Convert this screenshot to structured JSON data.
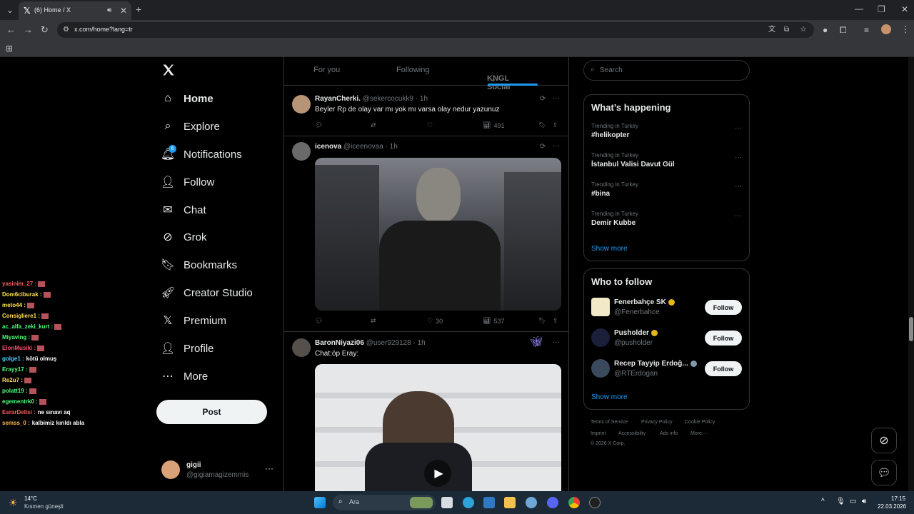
{
  "browser": {
    "tab_title": "(6) Home / X",
    "url": "x.com/home?lang=tr"
  },
  "nav": {
    "items": [
      {
        "label": "Home",
        "icon": "home-icon"
      },
      {
        "label": "Explore",
        "icon": "search-icon"
      },
      {
        "label": "Notifications",
        "icon": "bell-icon",
        "badge": "6"
      },
      {
        "label": "Follow",
        "icon": "person-plus-icon"
      },
      {
        "label": "Chat",
        "icon": "envelope-icon"
      },
      {
        "label": "Grok",
        "icon": "grok-icon"
      },
      {
        "label": "Bookmarks",
        "icon": "bookmark-icon"
      },
      {
        "label": "Creator Studio",
        "icon": "rocket-icon"
      },
      {
        "label": "Premium",
        "icon": "x-icon"
      },
      {
        "label": "Profile",
        "icon": "person-icon"
      },
      {
        "label": "More",
        "icon": "more-circle-icon"
      }
    ],
    "post_label": "Post",
    "account": {
      "name": "gigii",
      "handle": "@gigiamagizemmis"
    }
  },
  "feed": {
    "tabs": [
      "For you",
      "Following",
      "KNGL Social"
    ],
    "tweets": [
      {
        "name": "RayanCherki.",
        "handle": "@sekercocukk9",
        "time": "1h",
        "text": "Beyler Rp de olay var mı yok mı varsa olay nedur yazunuz",
        "likes": "",
        "views": "491"
      },
      {
        "name": "icenova",
        "handle": "@iceenovaa",
        "time": "1h",
        "text": "",
        "likes": "30",
        "views": "537"
      },
      {
        "name": "BaronNiyazi06",
        "handle": "@user929128",
        "time": "1h",
        "text": "Chat:öp Eray:",
        "likes": "",
        "views": ""
      }
    ]
  },
  "right": {
    "search_placeholder": "Search",
    "happening_title": "What’s happening",
    "trends": [
      {
        "category": "Trending in Turkey",
        "name": "#helikopter"
      },
      {
        "category": "Trending in Turkey",
        "name": "İstanbul Valisi Davut Gül"
      },
      {
        "category": "Trending in Turkey",
        "name": "#bina"
      },
      {
        "category": "Trending in Turkey",
        "name": "Demir Kubbe"
      }
    ],
    "show_more": "Show more",
    "who_title": "Who to follow",
    "follows": [
      {
        "name": "Fenerbahçe SK",
        "handle": "@Fenerbahce",
        "btn": "Follow"
      },
      {
        "name": "Pusholder",
        "handle": "@pusholder",
        "btn": "Follow"
      },
      {
        "name": "Recep Tayyip Erdoğ...",
        "handle": "@RTErdogan",
        "btn": "Follow"
      }
    ],
    "footer": [
      "Terms of Service",
      "Privacy Policy",
      "Cookie Policy",
      "Imprint",
      "Accessibility",
      "Ads info",
      "More ···",
      "© 2026 X Corp."
    ]
  },
  "chat_overlay": [
    {
      "user": "yasinim_27 :",
      "msg": "",
      "color": "#ff5a5a"
    },
    {
      "user": "Dom6ciburak :",
      "msg": "",
      "color": "#ffe14d"
    },
    {
      "user": "meto44 :",
      "msg": "",
      "color": "#ffe14d"
    },
    {
      "user": "Consigliere1 :",
      "msg": "",
      "color": "#ffe14d"
    },
    {
      "user": "ac_alfa_zeki_kurt :",
      "msg": "",
      "color": "#4dff7a"
    },
    {
      "user": "Miyaving :",
      "msg": "",
      "color": "#4dff7a"
    },
    {
      "user": "ElonMusiki :",
      "msg": "",
      "color": "#ff4d6d"
    },
    {
      "user": "golge1 :",
      "msg": "kötü olmuş",
      "color": "#4dd2ff"
    },
    {
      "user": "Erayy17 :",
      "msg": "",
      "color": "#4dff7a"
    },
    {
      "user": "Re2u7 :",
      "msg": "",
      "color": "#ffe14d"
    },
    {
      "user": "polatt19 :",
      "msg": "",
      "color": "#4dff7a"
    },
    {
      "user": "egementrk0 :",
      "msg": "",
      "color": "#4dff7a"
    },
    {
      "user": "EsrarDelisi :",
      "msg": "ne sınavı aq",
      "color": "#ff5a5a"
    },
    {
      "user": "semss_0 :",
      "msg": "kalbimiz kırıldı abla",
      "color": "#ffb84d"
    }
  ],
  "taskbar": {
    "weather_temp": "14°C",
    "weather_desc": "Kısmen güneşli",
    "search_placeholder": "Ara",
    "time": "17:15",
    "date": "22.03.2026"
  },
  "colors": {
    "accent": "#1d9bf0",
    "border": "#2f3336",
    "muted": "#71767b"
  }
}
